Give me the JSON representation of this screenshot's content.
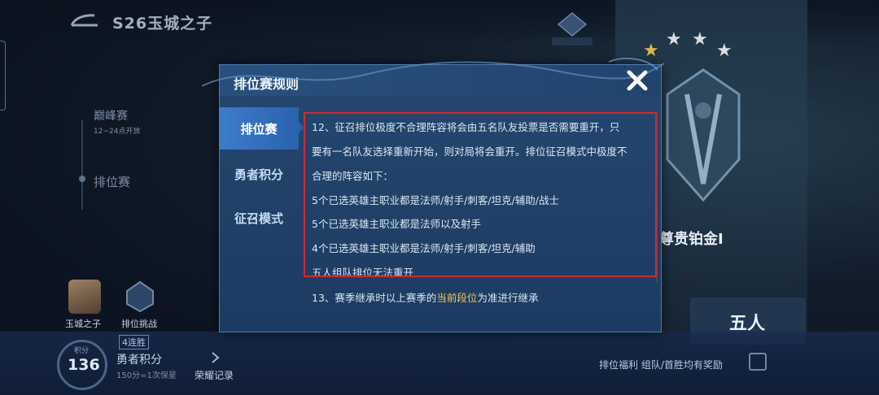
{
  "header": {
    "season_title": "S26玉城之子"
  },
  "background": {
    "modes": [
      {
        "name": "巅峰赛",
        "time": "12~24点开放"
      },
      {
        "name": "排位赛"
      }
    ],
    "bottom": {
      "profile_label": "玉城之子",
      "ranked_label": "排位挑战",
      "streak": "4连胜",
      "score_caption": "积分",
      "score": "136",
      "brave_points_label": "勇者积分",
      "brave_points_sub": "150分=1次保星",
      "honor_record": "荣耀记录",
      "benefit_text": "排位福利 组队/首胜均有奖励"
    },
    "rank_panel": {
      "rank_name": "尊贵铂金I",
      "five_button": "五人"
    }
  },
  "modal": {
    "title": "排位赛规则",
    "tabs": [
      {
        "label": "排位赛",
        "active": true
      },
      {
        "label": "勇者积分",
        "active": false
      },
      {
        "label": "征召模式",
        "active": false
      }
    ],
    "content": {
      "rule12_lines": [
        "12、征召排位极度不合理阵容将会由五名队友投票是否需要重开，只",
        "要有一名队友选择重新开始，则对局将会重开。排位征召模式中极度不",
        "合理的阵容如下：",
        "5个已选英雄主职业都是法师/射手/刺客/坦克/辅助/战士",
        "5个已选英雄主职业都是法师以及射手",
        "4个已选英雄主职业都是法师/射手/刺客/坦克/辅助",
        "五人组队排位无法重开"
      ],
      "rule13_prefix": "13、赛季继承时以上赛季的",
      "rule13_highlight": "当前段位",
      "rule13_suffix": "为准进行继承"
    }
  },
  "colors": {
    "highlight_box": "#d9272b",
    "highlight_text": "#f2c94c",
    "active_tab": "#3d7ccc"
  }
}
